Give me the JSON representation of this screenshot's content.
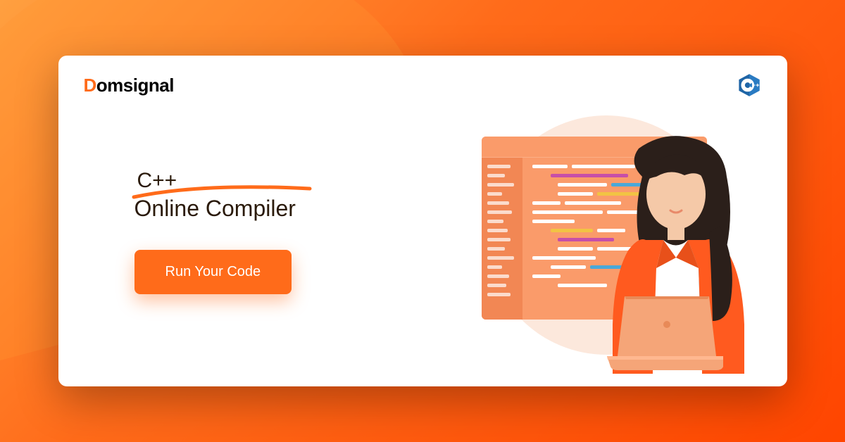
{
  "brand": {
    "prefix": "D",
    "name": "omsignal"
  },
  "badge": {
    "label": "C++"
  },
  "hero": {
    "language": "C++",
    "subtitle": "Online Compiler",
    "cta": "Run Your Code"
  },
  "colors": {
    "accent": "#ff6b1a",
    "badge_blue": "#1f65a6"
  }
}
